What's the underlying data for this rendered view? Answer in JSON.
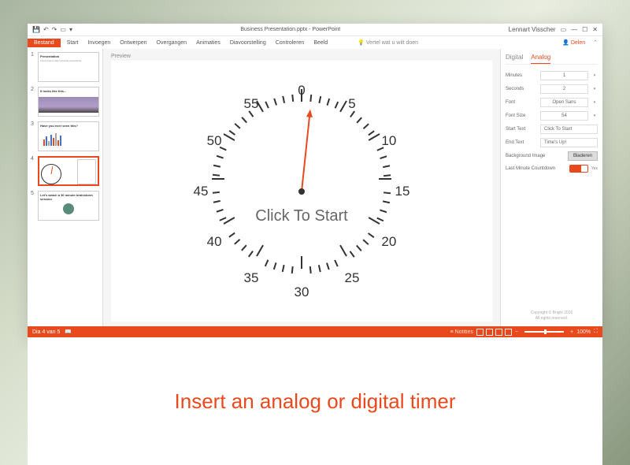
{
  "titlebar": {
    "doc_title": "Business Presentation.pptx - PowerPoint",
    "user": "Lennart Visscher"
  },
  "menu": {
    "file": "Bestand",
    "tabs": [
      "Start",
      "Invoegen",
      "Ontwerpen",
      "Overgangen",
      "Animaties",
      "Diavoorstelling",
      "Controleren",
      "Beeld"
    ],
    "tell_me": "Vertel wat u wilt doen",
    "share": "Delen"
  },
  "thumbs": [
    {
      "num": "1",
      "title": "Presentation",
      "text": "Lorem ipsum dolor sit amet consectetur"
    },
    {
      "num": "2",
      "title": "It looks like this..."
    },
    {
      "num": "3",
      "title": "Have you ever seen this?"
    },
    {
      "num": "4",
      "title": ""
    },
    {
      "num": "5",
      "title": "Let's watch a 30 minute brainstorm session"
    }
  ],
  "preview": {
    "label": "Preview",
    "clock_text": "Click To Start",
    "numbers": [
      "0",
      "5",
      "10",
      "15",
      "20",
      "25",
      "30",
      "35",
      "40",
      "45",
      "50",
      "55"
    ]
  },
  "panel": {
    "tab_digital": "Digital",
    "tab_analog": "Analog",
    "minutes_lbl": "Minutes",
    "minutes_val": "1",
    "seconds_lbl": "Seconds",
    "seconds_val": "2",
    "font_lbl": "Font",
    "font_val": "Open Sans",
    "fontsize_lbl": "Font Size",
    "fontsize_val": "54",
    "start_lbl": "Start Text",
    "start_val": "Click To Start",
    "end_lbl": "End Text",
    "end_val": "Time's Up!",
    "bg_lbl": "Background Image",
    "bg_btn": "Bladeren",
    "countdown_lbl": "Last Minute Countdown",
    "countdown_state": "Yes",
    "copyright": "Copyright © Bright 2016",
    "rights": "All rights reserved."
  },
  "status": {
    "slide": "Dia 4 van 5",
    "notes": "Notities",
    "zoom": "100%"
  },
  "caption": "Insert an analog or digital timer"
}
